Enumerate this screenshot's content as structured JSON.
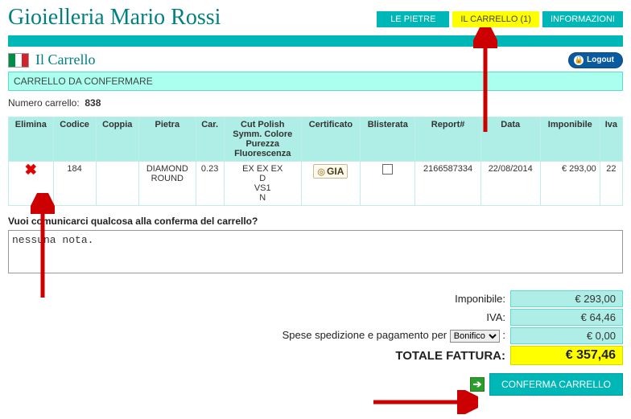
{
  "site_title": "Gioielleria Mario Rossi",
  "nav": {
    "pietre": "LE PIETRE",
    "carrello": "IL CARRELLO (1)",
    "info": "INFORMAZIONI"
  },
  "page_title": "Il Carrello",
  "logout_label": "Logout",
  "section_sub": "CARRELLO DA CONFERMARE",
  "cart_number_label": "Numero carrello:",
  "cart_number": "838",
  "table": {
    "headers": {
      "elimina": "Elimina",
      "codice": "Codice",
      "coppia": "Coppia",
      "pietra": "Pietra",
      "car": "Car.",
      "cut": "Cut Polish Symm. Colore Purezza Fluorescenza",
      "cert": "Certificato",
      "blist": "Blisterata",
      "report": "Report#",
      "data": "Data",
      "imponibile": "Imponibile",
      "iva": "Iva"
    },
    "row": {
      "codice": "184",
      "coppia": "",
      "pietra_line1": "DIAMOND",
      "pietra_line2": "ROUND",
      "car": "0.23",
      "cut_l1": "EX EX EX",
      "cut_l2": "D",
      "cut_l3": "VS1",
      "cut_l4": "N",
      "cert": "GIA",
      "report": "2166587334",
      "data": "22/08/2014",
      "imponibile": "€ 293,00",
      "iva": "22"
    }
  },
  "note_label": "Vuoi comunicarci qualcosa alla conferma del carrello?",
  "note_value": "nessuna nota.",
  "totals": {
    "imponibile_label": "Imponibile:",
    "imponibile_value": "€ 293,00",
    "iva_label": "IVA:",
    "iva_value": "€ 64,46",
    "spese_label_pre": "Spese spedizione e pagamento per",
    "spese_option": "Bonifico",
    "spese_value": "€ 0,00",
    "totale_label": "TOTALE FATTURA:",
    "totale_value": "€ 357,46"
  },
  "confirm_label": "CONFERMA CARRELLO"
}
